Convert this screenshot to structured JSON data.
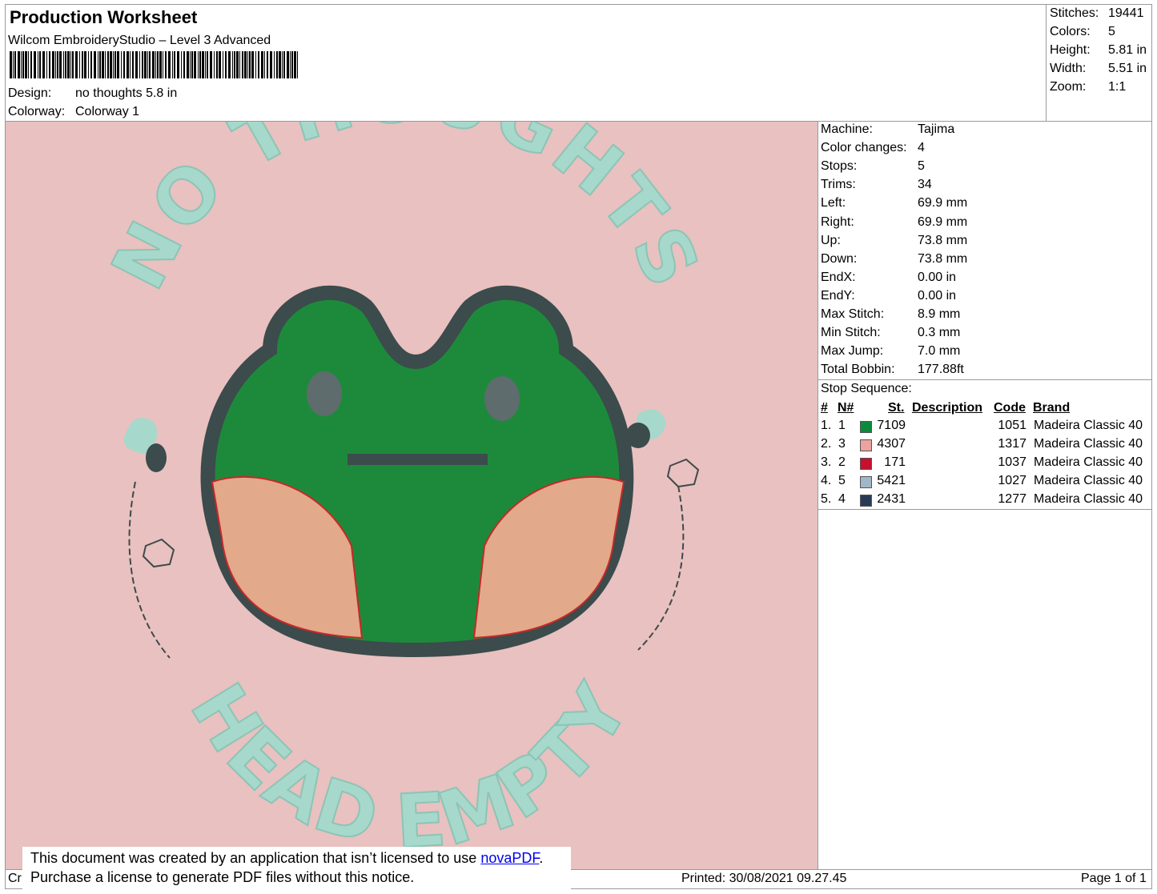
{
  "header": {
    "title": "Production Worksheet",
    "software": "Wilcom EmbroideryStudio – Level 3 Advanced",
    "design_label": "Design:",
    "design_value": "no thoughts 5.8 in",
    "colorway_label": "Colorway:",
    "colorway_value": "Colorway 1"
  },
  "summary": [
    {
      "label": "Stitches:",
      "value": "19441"
    },
    {
      "label": "Colors:",
      "value": "5"
    },
    {
      "label": "Height:",
      "value": "5.81 in"
    },
    {
      "label": "Width:",
      "value": "5.51 in"
    },
    {
      "label": "Zoom:",
      "value": "1:1"
    }
  ],
  "specs": [
    {
      "label": "Machine:",
      "value": "Tajima"
    },
    {
      "label": "Color changes:",
      "value": "4"
    },
    {
      "label": "Stops:",
      "value": "5"
    },
    {
      "label": "Trims:",
      "value": "34"
    },
    {
      "label": "Left:",
      "value": "69.9 mm"
    },
    {
      "label": "Right:",
      "value": "69.9 mm"
    },
    {
      "label": "Up:",
      "value": "73.8 mm"
    },
    {
      "label": "Down:",
      "value": "73.8 mm"
    },
    {
      "label": "EndX:",
      "value": "0.00 in"
    },
    {
      "label": "EndY:",
      "value": "0.00 in"
    },
    {
      "label": "Max Stitch:",
      "value": "8.9 mm"
    },
    {
      "label": "Min Stitch:",
      "value": "0.3 mm"
    },
    {
      "label": "Max Jump:",
      "value": "7.0 mm"
    },
    {
      "label": "Total Bobbin:",
      "value": "177.88ft"
    }
  ],
  "stop_sequence": {
    "label": "Stop Sequence:",
    "headers": {
      "num": "#",
      "n": "N#",
      "st": "St.",
      "desc": "Description",
      "code": "Code",
      "brand": "Brand"
    },
    "rows": [
      {
        "num": "1.",
        "n": "1",
        "color": "#0c8a3c",
        "st": "7109",
        "desc": "",
        "code": "1051",
        "brand": "Madeira Classic 40"
      },
      {
        "num": "2.",
        "n": "3",
        "color": "#eba39f",
        "st": "4307",
        "desc": "",
        "code": "1317",
        "brand": "Madeira Classic 40"
      },
      {
        "num": "3.",
        "n": "2",
        "color": "#c8102e",
        "st": "171",
        "desc": "",
        "code": "1037",
        "brand": "Madeira Classic 40"
      },
      {
        "num": "4.",
        "n": "5",
        "color": "#9fb7c8",
        "st": "5421",
        "desc": "",
        "code": "1027",
        "brand": "Madeira Classic 40"
      },
      {
        "num": "5.",
        "n": "4",
        "color": "#283a55",
        "st": "2431",
        "desc": "",
        "code": "1277",
        "brand": "Madeira Classic 40"
      }
    ]
  },
  "design_text": {
    "top": "NO THOUGHTS",
    "bottom": "HEAD EMPTY"
  },
  "colors": {
    "background": "#e8c1c0",
    "frog_green": "#1d8a3b",
    "outline": "#3c4b4c",
    "cheek": "#e2a98a",
    "text_mint": "#a6d9cb"
  },
  "footer": {
    "left_fragment": "Cr",
    "printed": "Printed: 30/08/2021 09.27.45",
    "page": "Page 1 of 1"
  },
  "notice": {
    "line1_pre": "This document was created by an application that isn’t licensed to use ",
    "link": "novaPDF",
    "line1_post": ".",
    "line2": "Purchase a license to generate PDF files without this notice."
  }
}
